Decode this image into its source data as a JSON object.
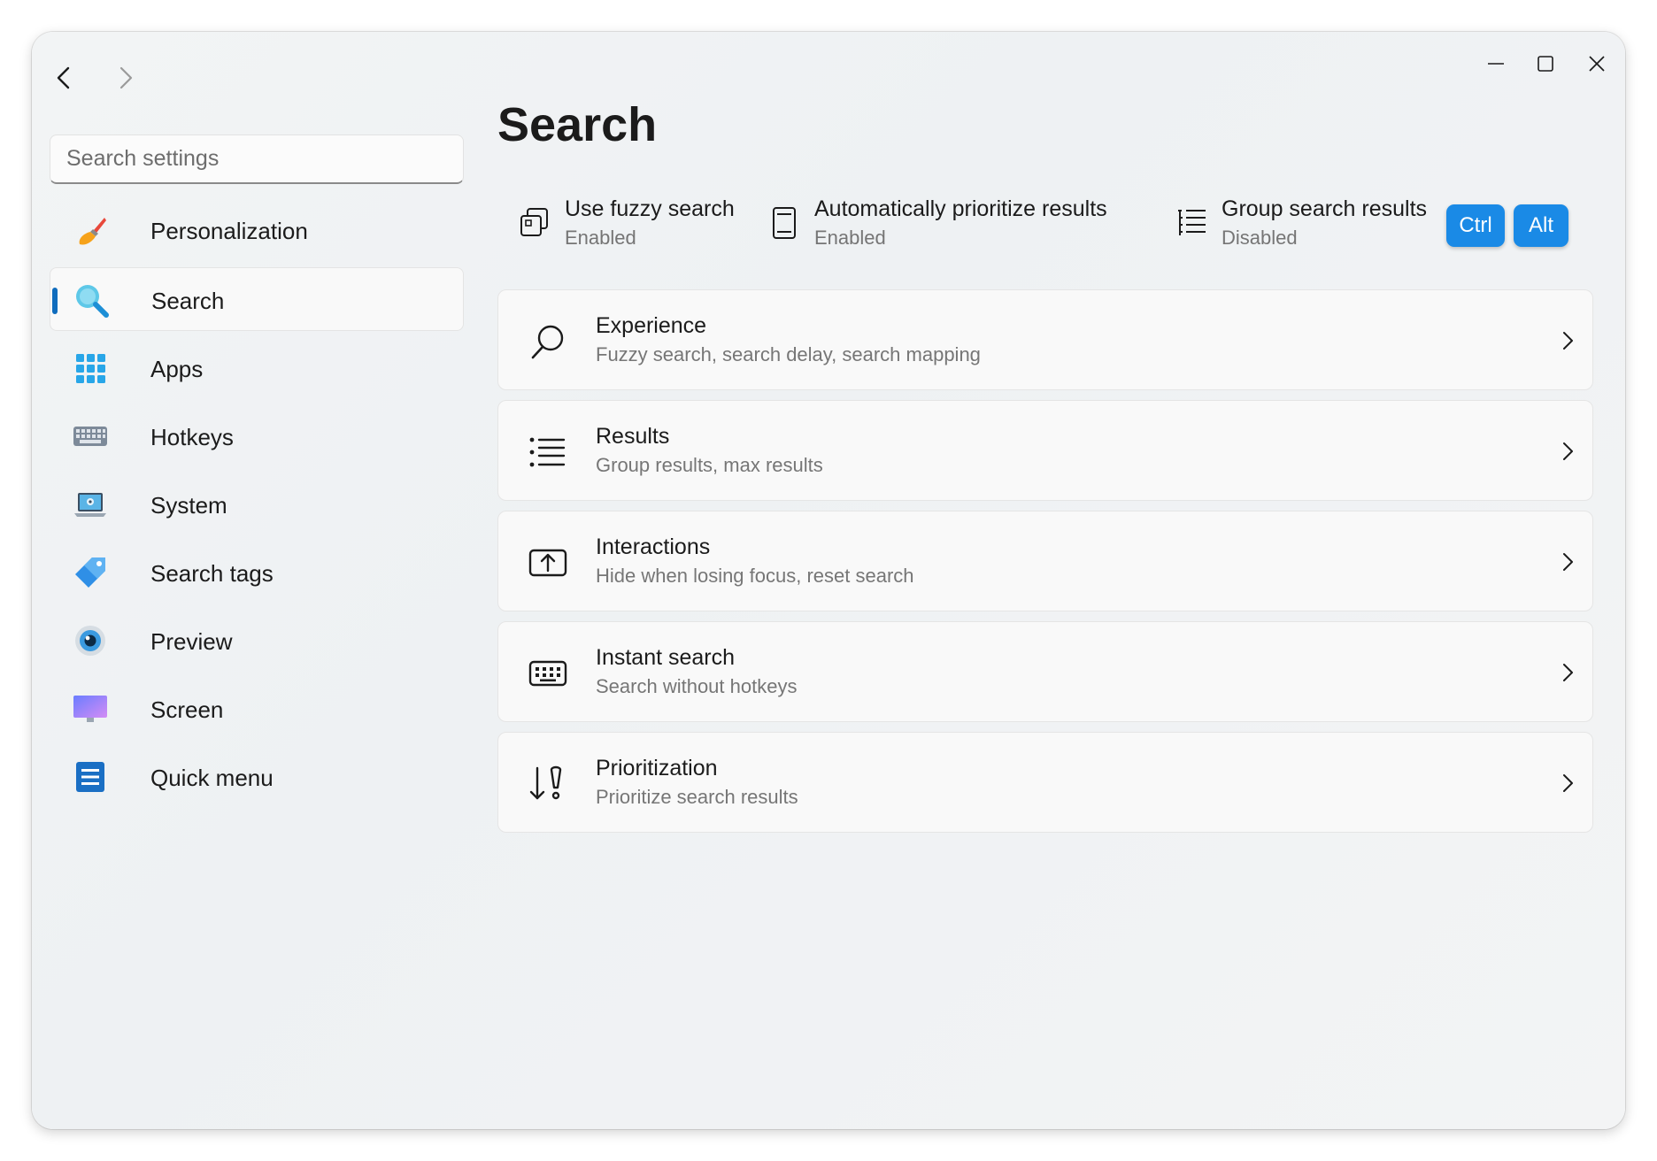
{
  "search": {
    "placeholder": "Search settings"
  },
  "sidebar": {
    "items": [
      {
        "label": "Personalization",
        "icon": "brush-icon"
      },
      {
        "label": "Search",
        "icon": "magnifier-icon",
        "active": true
      },
      {
        "label": "Apps",
        "icon": "apps-grid-icon"
      },
      {
        "label": "Hotkeys",
        "icon": "keyboard-icon"
      },
      {
        "label": "System",
        "icon": "laptop-icon"
      },
      {
        "label": "Search tags",
        "icon": "tag-icon"
      },
      {
        "label": "Preview",
        "icon": "eye-icon"
      },
      {
        "label": "Screen",
        "icon": "monitor-icon"
      },
      {
        "label": "Quick menu",
        "icon": "menu-list-icon"
      }
    ]
  },
  "main": {
    "title": "Search",
    "quick_toggles": [
      {
        "label": "Use fuzzy search",
        "state": "Enabled",
        "icon": "copy-icon"
      },
      {
        "label": "Automatically prioritize results",
        "state": "Enabled",
        "icon": "document-icon"
      },
      {
        "label": "Group search results",
        "state": "Disabled",
        "icon": "list-tree-icon"
      }
    ],
    "keys": [
      "Ctrl",
      "Alt"
    ],
    "cards": [
      {
        "title": "Experience",
        "subtitle": "Fuzzy search, search delay, search mapping",
        "icon": "search-icon"
      },
      {
        "title": "Results",
        "subtitle": "Group results, max results",
        "icon": "bullet-list-icon"
      },
      {
        "title": "Interactions",
        "subtitle": "Hide when losing focus, reset search",
        "icon": "upload-box-icon"
      },
      {
        "title": "Instant search",
        "subtitle": "Search without hotkeys",
        "icon": "keyboard-icon"
      },
      {
        "title": "Prioritization",
        "subtitle": "Prioritize search results",
        "icon": "sort-priority-icon"
      }
    ]
  },
  "colors": {
    "accent": "#0f6cbd",
    "key_badge": "#1a8ae6"
  }
}
